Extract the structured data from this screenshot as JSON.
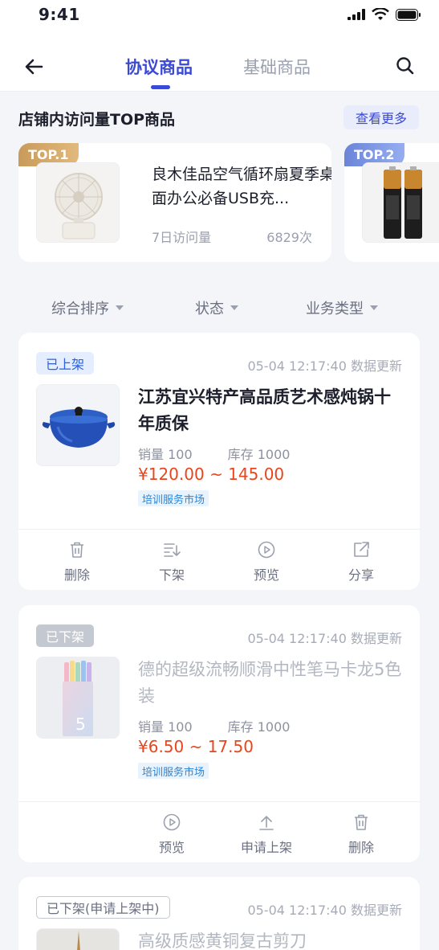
{
  "status_bar": {
    "time": "9:41"
  },
  "nav": {
    "tabs": [
      {
        "label": "协议商品",
        "active": true
      },
      {
        "label": "基础商品",
        "active": false
      }
    ]
  },
  "top_section": {
    "title": "店铺内访问量TOP商品",
    "see_more": "查看更多",
    "cards": [
      {
        "rank": "TOP.1",
        "title": "良木佳品空气循环扇夏季桌面办公必备USB充...",
        "visit_label": "7日访问量",
        "visit_value": "6829次"
      },
      {
        "rank": "TOP.2"
      }
    ]
  },
  "filters": [
    {
      "label": "综合排序"
    },
    {
      "label": "状态"
    },
    {
      "label": "业务类型"
    }
  ],
  "products": [
    {
      "status": "已上架",
      "date": "05-04",
      "time": "12:17:40",
      "update_text": "数据更新",
      "title": "江苏宜兴特产高品质艺术感炖锅十年质保",
      "sales": "销量  100",
      "stock": "库存 1000",
      "price": "¥120.00 ~ 145.00",
      "market": "培训服务市场",
      "actions": [
        "删除",
        "下架",
        "预览",
        "分享"
      ]
    },
    {
      "status": "已下架",
      "date": "05-04",
      "time": "12:17:40",
      "update_text": "数据更新",
      "title": "德的超级流畅顺滑中性笔马卡龙5色装",
      "sales": "销量  100",
      "stock": "库存 1000",
      "price": "¥6.50 ~ 17.50",
      "market": "培训服务市场",
      "actions": [
        "预览",
        "申请上架",
        "删除"
      ]
    },
    {
      "status": "已下架(申请上架中)",
      "date": "05-04",
      "time": "12:17:40",
      "update_text": "数据更新",
      "title": "高级质感黄铜复古剪刀"
    }
  ],
  "colors": {
    "accent": "#3a49d6",
    "price": "#e8451c",
    "tag_on": "#2a62dd"
  }
}
